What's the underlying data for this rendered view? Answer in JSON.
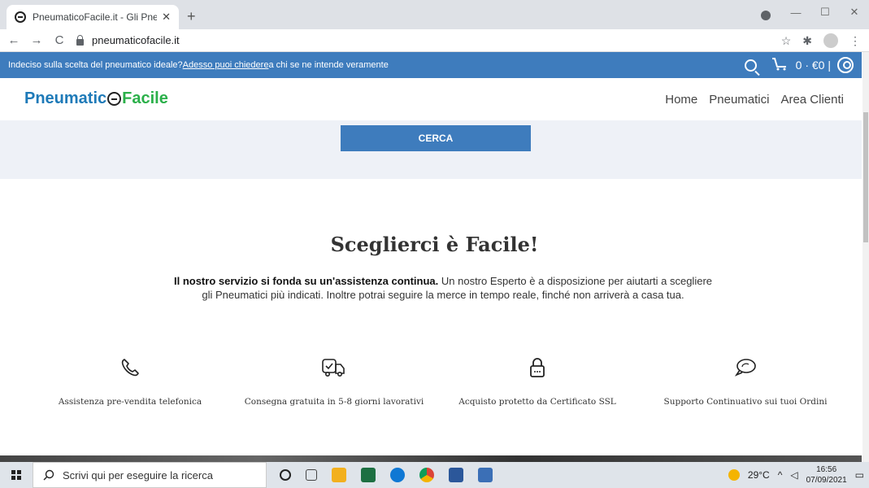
{
  "browser": {
    "tab_title": "PneumaticoFacile.it - Gli Pneuma",
    "tab_close": "✕",
    "new_tab": "+",
    "url": "pneumaticofacile.it",
    "back": "←",
    "forward": "→",
    "reload": "C",
    "star": "☆",
    "extensions": "✱",
    "menu": "⋮",
    "minimize": "—",
    "maximize": "☐",
    "close": "✕"
  },
  "topbar": {
    "text_before": "Indeciso sulla scelta del pneumatico ideale? ",
    "link": "Adesso puoi chiedere",
    "text_after": " a chi se ne intende veramente",
    "cart": "0 · €0 |"
  },
  "logo": {
    "part1": "Pneumatic",
    "part2": "Facile"
  },
  "menu": [
    "Home",
    "Pneumatici",
    "Area Clienti"
  ],
  "search_band": {
    "button": "CERCA"
  },
  "section": {
    "title": "Sceglierci è Facile!",
    "bold": "Il nostro servizio si fonda su un'assistenza continua.",
    "line1_rest": " Un nostro Esperto è a disposizione per aiutarti a scegliere",
    "line2": "gli Pneumatici più indicati. Inoltre potrai seguire la merce in tempo reale, finché non arriverà a casa tua."
  },
  "features": [
    {
      "icon": "phone-icon",
      "label": "Assistenza pre-vendita telefonica"
    },
    {
      "icon": "delivery-truck-icon",
      "label": "Consegna gratuita in 5-8 giorni lavorativi"
    },
    {
      "icon": "lock-icon",
      "label": "Acquisto protetto da Certificato SSL"
    },
    {
      "icon": "chat-bubbles-icon",
      "label": "Supporto Continuativo sui tuoi Ordini"
    }
  ],
  "taskbar": {
    "search_placeholder": "Scrivi qui per eseguire la ricerca",
    "temperature": "29°C",
    "time": "16:56",
    "date": "07/09/2021"
  }
}
